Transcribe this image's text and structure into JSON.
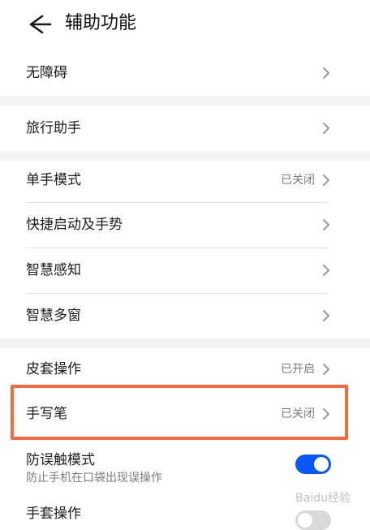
{
  "header": {
    "title": "辅助功能",
    "back_icon": "arrow-left-icon"
  },
  "groups": [
    {
      "items": [
        {
          "label": "无障碍",
          "value": ""
        }
      ]
    },
    {
      "items": [
        {
          "label": "旅行助手",
          "value": ""
        }
      ]
    },
    {
      "items": [
        {
          "label": "单手模式",
          "value": "已关闭"
        },
        {
          "label": "快捷启动及手势",
          "value": ""
        },
        {
          "label": "智慧感知",
          "value": ""
        },
        {
          "label": "智慧多窗",
          "value": ""
        }
      ]
    },
    {
      "items": [
        {
          "label": "皮套操作",
          "value": "已开启"
        },
        {
          "label": "手写笔",
          "value": "已关闭"
        }
      ]
    }
  ],
  "toggles": [
    {
      "label": "防误触模式",
      "sub": "防止手机在口袋出现误操作",
      "on": true
    },
    {
      "label": "手套操作",
      "sub": "",
      "on": false
    }
  ],
  "colors": {
    "accent": "#0a59f7",
    "highlight_border": "#f26a3d",
    "separator_band": "#f1f3f5"
  },
  "watermark": "Baidu经验"
}
